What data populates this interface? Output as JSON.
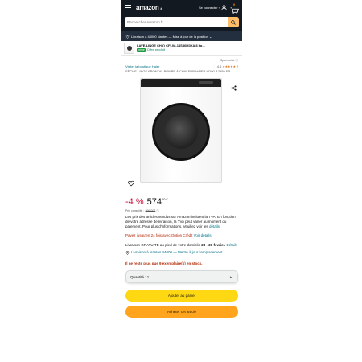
{
  "header": {
    "logo_text": "amazon",
    "logo_suffix": ".fr",
    "signin_label": "Se connecter ›",
    "cart_count": "0"
  },
  "search": {
    "placeholder": "Rechercher Amazon.fr"
  },
  "delivery_bar": {
    "text": "Livraison à 44000 Nantes — Mise à jour de la position ⌄"
  },
  "recent_item": {
    "title": "LAVE-LINGE CHIQ CFL08-14S86M3XA 8 kg...",
    "badge": "prime",
    "subtitle": "Offre produit"
  },
  "sponsored_label": "Sponsorisé ⓘ",
  "product": {
    "store_link": "Visiter la boutique Haier",
    "rating_value": "4,6",
    "stars": "★★★★★",
    "rating_count": "2",
    "title": "SÈCHE-LINGE FRONTAL POMPE À CHALEUR HAIER HD90-A2959-FR"
  },
  "pricing": {
    "discount": "-4 %",
    "price": "574",
    "price_cents": "00 €",
    "previous_label": "Prix conseillé :",
    "previous_price": "599,00€",
    "previous_info": "ⓘ"
  },
  "tva": {
    "text": "Les prix des articles vendus sur Amazon incluent la TVA. En fonction de votre adresse de livraison, la TVA peut varier au moment du paiement. Pour plus d'informations, Veuillez voir les",
    "link": "détails."
  },
  "installments": {
    "text": "Payez jusqu'en 24 fois avec Option Crédit",
    "link": "Voir détails"
  },
  "shipping": {
    "free_text": "Livraison GRATUITE au pied de votre domicile",
    "date": "23 - 26 février.",
    "link": "Détails"
  },
  "delivery_location": {
    "text": "Livraison à Nantes 44000 — Mettre à jour l'emplacement"
  },
  "stock": "Il ne reste plus que 9 exemplaire(s) en stock.",
  "quantity": {
    "label": "Quantité : 1"
  },
  "buttons": {
    "add_to_cart": "Ajouter au panier",
    "buy_now": "Acheter cet article"
  },
  "colors": {
    "nav_dark": "#131921",
    "nav_sub": "#232f3e",
    "search_button": "#febd69",
    "cart_button": "#ffd814",
    "buy_button": "#ffa41c",
    "link": "#007185",
    "deal_red": "#cc0c39"
  },
  "icons": [
    "menu-icon",
    "user-icon",
    "cart-icon",
    "search-icon",
    "location-pin-icon",
    "share-icon",
    "heart-icon",
    "chevron-down-icon"
  ]
}
